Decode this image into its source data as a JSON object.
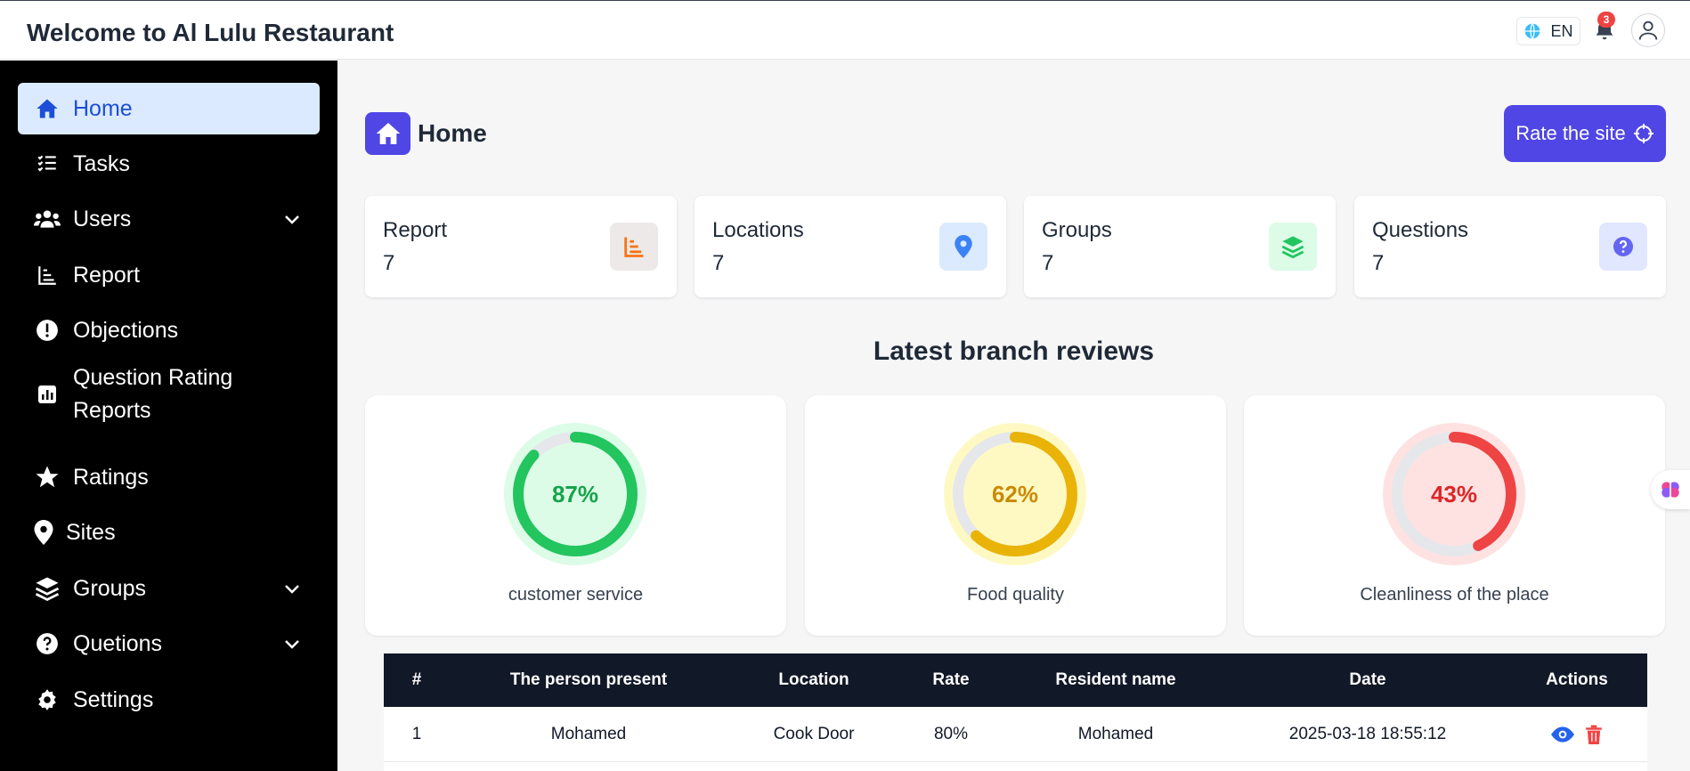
{
  "header": {
    "title": "Welcome to Al Lulu Restaurant",
    "lang": "EN",
    "notifications_count": "3"
  },
  "sidebar": {
    "items": [
      {
        "label": "Home",
        "icon": "home-icon",
        "active": true
      },
      {
        "label": "Tasks",
        "icon": "tasks-icon"
      },
      {
        "label": "Users",
        "icon": "users-icon",
        "expandable": true
      },
      {
        "label": "Report",
        "icon": "report-icon"
      },
      {
        "label": "Objections",
        "icon": "exclamation-icon"
      },
      {
        "label": "Question Rating Reports",
        "icon": "chart-icon"
      },
      {
        "label": "Ratings",
        "icon": "star-icon"
      },
      {
        "label": "Sites",
        "icon": "map-pin-icon"
      },
      {
        "label": "Groups",
        "icon": "layers-icon",
        "expandable": true
      },
      {
        "label": "Quetions",
        "icon": "question-icon",
        "expandable": true
      },
      {
        "label": "Settings",
        "icon": "gear-icon"
      }
    ]
  },
  "page": {
    "title": "Home",
    "rate_button": "Rate the site"
  },
  "stats": [
    {
      "label": "Report",
      "value": "7",
      "icon": "report-icon",
      "color": "#f97316"
    },
    {
      "label": "Locations",
      "value": "7",
      "icon": "map-pin-icon",
      "color": "#3b82f6"
    },
    {
      "label": "Groups",
      "value": "7",
      "icon": "layers-icon",
      "color": "#22c55e"
    },
    {
      "label": "Questions",
      "value": "7",
      "icon": "question-icon",
      "color": "#6366f1"
    }
  ],
  "reviews": {
    "title": "Latest branch reviews",
    "items": [
      {
        "label": "customer service",
        "percent": 87,
        "text": "87%",
        "color": "#22c55e",
        "bg": "#dcfce7",
        "textColor": "#16a34a"
      },
      {
        "label": "Food quality",
        "percent": 62,
        "text": "62%",
        "color": "#eab308",
        "bg": "#fef9c3",
        "textColor": "#ca8a04"
      },
      {
        "label": "Cleanliness of the place",
        "percent": 43,
        "text": "43%",
        "color": "#ef4444",
        "bg": "#fee2e2",
        "textColor": "#dc2626"
      }
    ]
  },
  "table": {
    "headers": [
      "#",
      "The person present",
      "Location",
      "Rate",
      "Resident name",
      "Date",
      "Actions"
    ],
    "rows": [
      [
        "1",
        "Mohamed",
        "Cook Door",
        "80%",
        "Mohamed",
        "2025-03-18 18:55:12"
      ]
    ]
  }
}
